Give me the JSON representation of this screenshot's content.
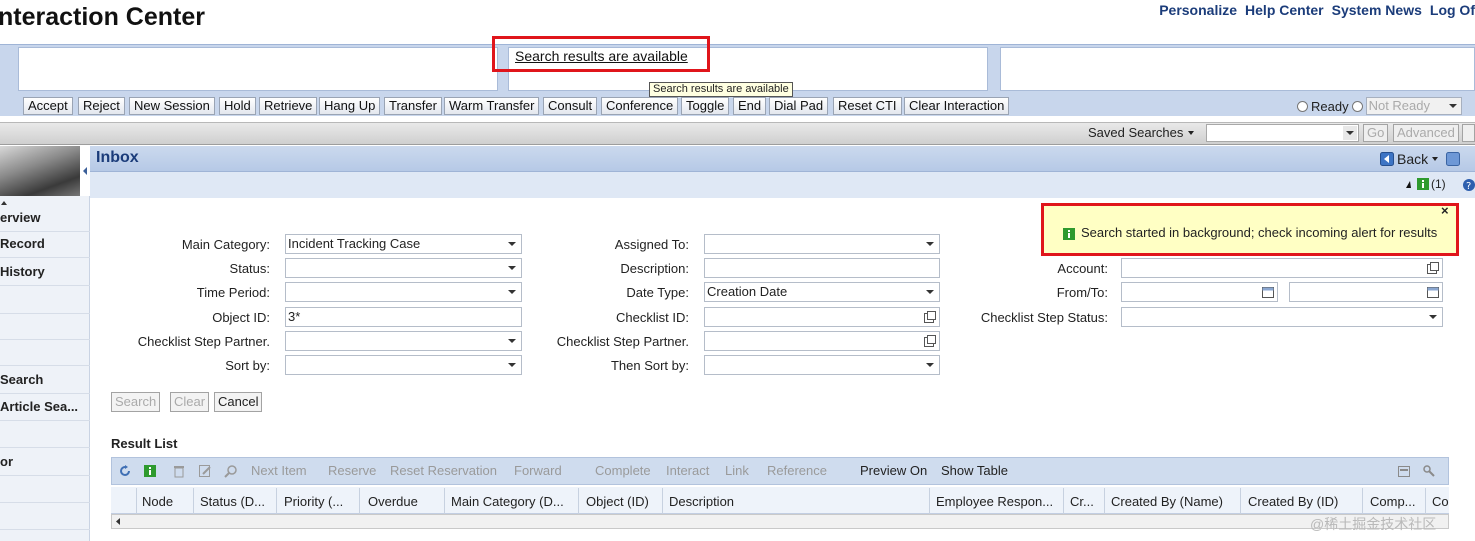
{
  "header": {
    "title": "nteraction Center",
    "links": [
      "Personalize",
      "Help Center",
      "System News",
      "Log Of"
    ]
  },
  "cti": {
    "notice": "Search results are available",
    "tooltip": "Search results are available",
    "buttons": [
      "Accept",
      "Reject",
      "New Session",
      "Hold",
      "Retrieve",
      "Hang Up",
      "Transfer",
      "Warm Transfer",
      "Consult",
      "Conference",
      "Toggle",
      "End",
      "Dial Pad",
      "Reset CTI",
      "Clear Interaction"
    ],
    "ready_label": "Ready",
    "not_ready_label": "Not Ready"
  },
  "saved_search": {
    "label": "Saved Searches",
    "go": "Go",
    "advanced": "Advanced"
  },
  "nav": {
    "items": [
      "erview",
      "Record",
      "History",
      "",
      "",
      "",
      "Search",
      "Article Sea...",
      "",
      "or",
      "",
      ""
    ]
  },
  "inbox": {
    "title": "Inbox",
    "back": "Back",
    "alert_count": "(1)"
  },
  "notification": {
    "text": "Search started in background; check incoming alert for results",
    "close": "×"
  },
  "form": {
    "main_category_label": "Main Category:",
    "main_category_value": "Incident Tracking Case",
    "status_label": "Status:",
    "time_period_label": "Time Period:",
    "object_id_label": "Object ID:",
    "object_id_value": "3*",
    "checklist_step_partner_label": "Checklist Step Partner.",
    "sort_by_label": "Sort by:",
    "assigned_to_label": "Assigned To:",
    "description_label": "Description:",
    "date_type_label": "Date Type:",
    "date_type_value": "Creation Date",
    "checklist_id_label": "Checklist ID:",
    "checklist_step_partner2_label": "Checklist Step Partner.",
    "then_sort_by_label": "Then Sort by:",
    "account_label": "Account:",
    "from_to_label": "From/To:",
    "checklist_step_status_label": "Checklist Step Status:",
    "search": "Search",
    "clear": "Clear",
    "cancel": "Cancel"
  },
  "result_list": {
    "title": "Result List",
    "toolbar": [
      "Next Item",
      "Reserve",
      "Reset Reservation",
      "Forward",
      "Complete",
      "Interact",
      "Link",
      "Reference",
      "Preview On",
      "Show Table"
    ],
    "columns": [
      "Node",
      "Status (D...",
      "Priority (...",
      "Overdue",
      "Main Category (D...",
      "Object (ID)",
      "Description",
      "Employee Respon...",
      "Cr...",
      "Created By (Name)",
      "Created By (ID)",
      "Comp...",
      "Co"
    ]
  },
  "watermark": "@稀土掘金技术社区"
}
